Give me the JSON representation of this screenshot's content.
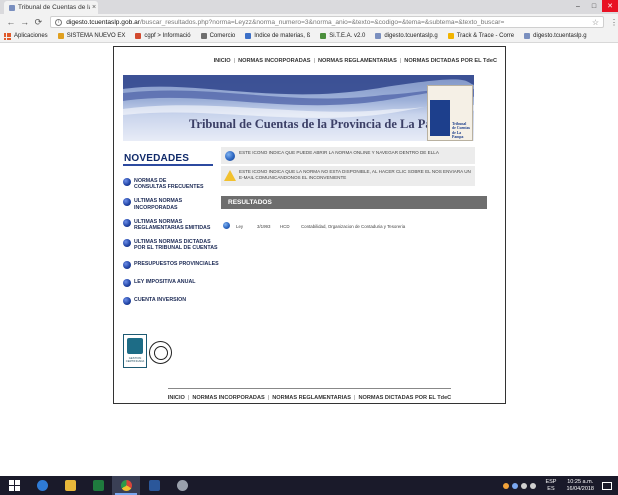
{
  "browser": {
    "tab_title": "Tribunal de Cuentas de la",
    "tab_close": "×",
    "window_controls": {
      "minimize": "–",
      "maximize": "□",
      "close": "✕"
    },
    "nav": {
      "back": "←",
      "forward": "→",
      "reload": "⟳"
    },
    "url_host": "digesto.tcuentaslp.gob.ar",
    "url_path": "/buscar_resultados.php?norma=Leyzz&norma_numero=3&norma_anio=&texto=&codigo=&tema=&subtema=&texto_buscar=",
    "bookmarks": [
      {
        "label": "Aplicaciones",
        "icon": "apps-icon",
        "color": "#e05a2b"
      },
      {
        "label": "SISTEMA NUEVO EX",
        "icon": "page-icon",
        "color": "#e0a020"
      },
      {
        "label": "cgpf > Informació",
        "icon": "page-icon",
        "color": "#d24a2f"
      },
      {
        "label": "Comercio",
        "icon": "page-icon",
        "color": "#6e6e6e"
      },
      {
        "label": "Indice de materias, ß",
        "icon": "page-icon",
        "color": "#3c70c8"
      },
      {
        "label": "Si.T.E.A. v2.0",
        "icon": "page-icon",
        "color": "#4b8f3c"
      },
      {
        "label": "digesto.tcuentaslp.g",
        "icon": "page-icon",
        "color": "#7a8fbf"
      },
      {
        "label": "Track & Trace - Corre",
        "icon": "page-icon",
        "color": "#f2b400"
      },
      {
        "label": "digesto.tcuentaslp.g",
        "icon": "page-icon",
        "color": "#7a8fbf"
      }
    ]
  },
  "site": {
    "top_nav": [
      "INICIO",
      "NORMAS INCORPORADAS",
      "NORMAS REGLAMENTARIAS",
      "NORMAS DICTADAS POR EL TdeC"
    ],
    "banner_title": "Tribunal de Cuentas de la Provincia de La Pampa",
    "logo_text_1": "Tribunal",
    "logo_text_2": "de Cuentas",
    "logo_text_3": "de La Pampa",
    "section_title": "NOVEDADES",
    "menu": [
      {
        "line1": "NORMAS DE",
        "line2": "CONSULTAS FRECUENTES"
      },
      {
        "line1": "ULTIMAS NORMAS",
        "line2": "INCORPORADAS"
      },
      {
        "line1": "ULTIMAS NORMAS",
        "line2": "REGLAMENTARIAS EMITIDAS"
      },
      {
        "line1": "ULTIMAS NORMAS DICTADAS",
        "line2": "POR EL TRIBUNAL DE CUENTAS"
      },
      {
        "line1": "PRESUPUESTOS PROVINCIALES",
        "line2": ""
      },
      {
        "line1": "LEY IMPOSITIVA ANUAL",
        "line2": ""
      },
      {
        "line1": "CUENTA INVERSION",
        "line2": ""
      }
    ],
    "notice_online": "ESTE ICONO INDICA QUE PUEDE ABRIR LA NORMA ONLINE Y NAVEGAR DENTRO DE ELLA",
    "notice_offline_1": "ESTE ICONO INDICA QUE LA NORMA NO ESTA DISPONIBLE, AL HACER CLIC SOBRE EL NOS ENVIARA UN",
    "notice_offline_2": "E-MAIL COMUNICANDONOS EL INCONVENIENTE",
    "results_title": "RESULTADOS",
    "results": [
      {
        "tipo": "Ley",
        "numero": "3/1993",
        "organismo": "HCD",
        "tema": "Contabilidad, Organizacion de Contaduria y Tesoreria"
      }
    ],
    "bottom_nav": [
      "INICIO",
      "NORMAS INCORPORADAS",
      "NORMAS REGLAMENTARIAS",
      "NORMAS DICTADAS POR EL TdeC"
    ]
  },
  "taskbar": {
    "apps": [
      {
        "name": "internet-explorer",
        "color": "#2f7bd6"
      },
      {
        "name": "file-explorer",
        "color": "#e8b83a"
      },
      {
        "name": "excel",
        "color": "#1f7a3e"
      },
      {
        "name": "chrome",
        "color": "#d8443a"
      },
      {
        "name": "word-doc",
        "color": "#2b579a"
      },
      {
        "name": "media-app",
        "color": "#9aa0ac"
      }
    ],
    "lang_1": "ESP",
    "lang_2": "ES",
    "time": "10:25 a.m.",
    "date": "16/04/2018",
    "colors": {
      "taskbar": "#1a1a2a",
      "accent": "#7aa7f0"
    }
  }
}
